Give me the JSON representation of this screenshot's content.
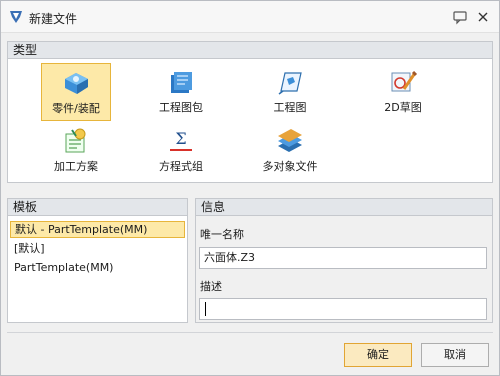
{
  "window": {
    "title": "新建文件"
  },
  "type_section": {
    "header": "类型",
    "items": [
      {
        "label": "零件/装配",
        "icon": "part-assembly-icon",
        "selected": true
      },
      {
        "label": "工程图包",
        "icon": "drawing-package-icon",
        "selected": false
      },
      {
        "label": "工程图",
        "icon": "drawing-icon",
        "selected": false
      },
      {
        "label": "2D草图",
        "icon": "sketch-2d-icon",
        "selected": false
      },
      {
        "label": "加工方案",
        "icon": "machining-plan-icon",
        "selected": false
      },
      {
        "label": "方程式组",
        "icon": "equation-set-icon",
        "selected": false
      },
      {
        "label": "多对象文件",
        "icon": "multi-object-file-icon",
        "selected": false
      }
    ]
  },
  "template_section": {
    "header": "模板",
    "items": [
      {
        "label": "默认 - PartTemplate(MM)",
        "selected": true
      },
      {
        "label": "[默认]",
        "selected": false
      },
      {
        "label": "PartTemplate(MM)",
        "selected": false
      }
    ]
  },
  "info_section": {
    "header": "信息",
    "unique_name_label": "唯一名称",
    "unique_name_value": "六面体.Z3",
    "description_label": "描述",
    "description_value": ""
  },
  "buttons": {
    "ok": "确定",
    "cancel": "取消"
  },
  "colors": {
    "selection_fill": "#fde9a8",
    "selection_border": "#e7b53b",
    "header_bg": "#e3e6ea"
  }
}
